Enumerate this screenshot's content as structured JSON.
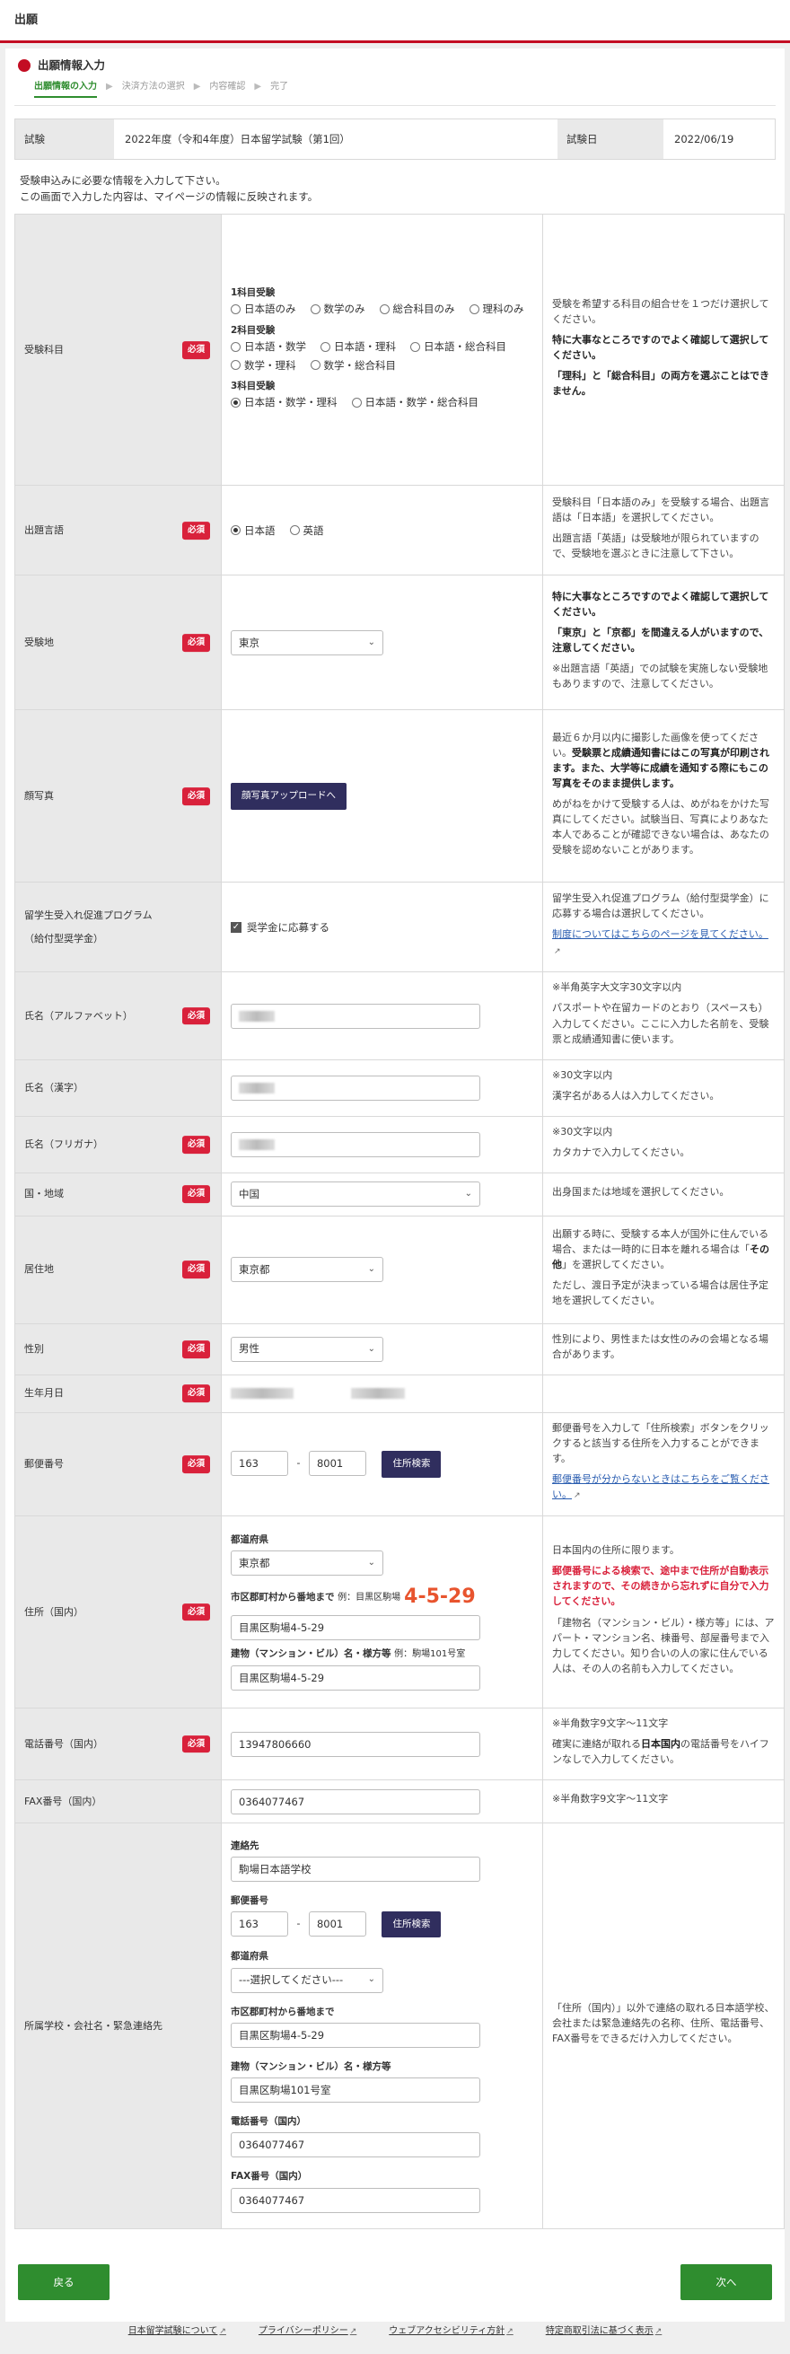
{
  "header": {
    "title": "出願"
  },
  "section": {
    "title": "出願情報入力"
  },
  "steps": [
    "出願情報の入力",
    "決済方法の選択",
    "内容確認",
    "完了"
  ],
  "exam": {
    "label": "試験",
    "value": "2022年度（令和4年度）日本留学試験（第1回）",
    "date_label": "試験日",
    "date_value": "2022/06/19"
  },
  "intro": [
    "受験申込みに必要な情報を入力して下さい。",
    "この画面で入力した内容は、マイページの情報に反映されます。"
  ],
  "required": "必須",
  "subjects": {
    "label": "受験科目",
    "g1": "1科目受験",
    "g1_options": [
      "日本語のみ",
      "数学のみ",
      "総合科目のみ",
      "理科のみ"
    ],
    "g2": "2科目受験",
    "g2_options": [
      "日本語・数学",
      "日本語・理科",
      "日本語・総合科目",
      "数学・理科",
      "数学・総合科目"
    ],
    "g3": "3科目受験",
    "g3_options": [
      "日本語・数学・理科",
      "日本語・数学・総合科目"
    ],
    "note1": "受験を希望する科目の組合せを１つだけ選択してください。",
    "note2": "特に大事なところですのでよく確認して選択してください。",
    "note3": "「理科」と「総合科目」の両方を選ぶことはできません。"
  },
  "language": {
    "label": "出題言語",
    "options": [
      "日本語",
      "英語"
    ],
    "note1": "受験科目「日本語のみ」を受験する場合、出題言語は「日本語」を選択してください。",
    "note2": "出題言語「英語」は受験地が限られていますので、受験地を選ぶときに注意して下さい。"
  },
  "venue": {
    "label": "受験地",
    "value": "東京",
    "note1": "特に大事なところですのでよく確認して選択してください。",
    "note2": "「東京」と「京都」を間違える人がいますので、注意してください。",
    "note3": "※出題言語「英語」での試験を実施しない受験地もありますので、注意してください。"
  },
  "photo": {
    "label": "顔写真",
    "button": "顔写真アップロードへ",
    "note1a": "最近６か月以内に撮影した画像を使ってください。",
    "note1b": "受験票と成績通知書にはこの写真が印刷されます。また、大学等に成績を通知する際にもこの写真をそのまま提供します。",
    "note2": "めがねをかけて受験する人は、めがねをかけた写真にしてください。試験当日、写真によりあなた本人であることが確認できない場合は、あなたの受験を認めないことがあります。"
  },
  "scholarship": {
    "label1": "留学生受入れ促進プログラム",
    "label2": "（給付型奨学金）",
    "checkbox": "奨学金に応募する",
    "note1": "留学生受入れ促進プログラム（給付型奨学金）に応募する場合は選択してください。",
    "link": "制度についてはこちらのページを見てください。"
  },
  "name_alpha": {
    "label": "氏名（アルファベット）",
    "note1": "※半角英字大文字30文字以内",
    "note2": "パスポートや在留カードのとおり（スペースも）入力してください。ここに入力した名前を、受験票と成績通知書に使います。"
  },
  "name_kanji": {
    "label": "氏名（漢字）",
    "note1": "※30文字以内",
    "note2": "漢字名がある人は入力してください。"
  },
  "name_kana": {
    "label": "氏名（フリガナ）",
    "note1": "※30文字以内",
    "note2": "カタカナで入力してください。"
  },
  "country": {
    "label": "国・地域",
    "value": "中国",
    "note": "出身国または地域を選択してください。"
  },
  "residence": {
    "label": "居住地",
    "value": "東京都",
    "note1a": "出願する時に、受験する本人が国外に住んでいる場合、または一時的に日本を離れる場合は「",
    "note1b": "その他",
    "note1c": "」を選択してください。",
    "note2": "ただし、渡日予定が決まっている場合は居住予定地を選択してください。"
  },
  "gender": {
    "label": "性別",
    "value": "男性",
    "note": "性別により、男性または女性のみの会場となる場合があります。"
  },
  "birth": {
    "label": "生年月日"
  },
  "postal": {
    "label": "郵便番号",
    "p1": "163",
    "p2": "8001",
    "dash": "-",
    "button": "住所検索",
    "note": "郵便番号を入力して「住所検索」ボタンをクリックすると該当する住所を入力することができます。",
    "link": "郵便番号が分からないときはこちらをご覧ください。"
  },
  "address": {
    "label": "住所（国内）",
    "pref_label": "都道府県",
    "pref": "東京都",
    "city_label": "市区郡町村から番地まで",
    "city_ex": "例：目黒区駒場",
    "big": "4-5-29",
    "city": "目黒区駒場4-5-29",
    "bldg_label": "建物（マンション・ビル）名・様方等",
    "bldg_ex": "例：駒場101号室",
    "bldg": "目黒区駒場4-5-29",
    "note1": "日本国内の住所に限ります。",
    "note2": "郵便番号による検索で、途中まで住所が自動表示されますので、その続きから忘れずに自分で入力してください。",
    "note3": "「建物名（マンション・ビル）・様方等」には、アパート・マンション名、棟番号、部屋番号まで入力してください。知り合いの人の家に住んでいる人は、その人の名前も入力してください。"
  },
  "phone": {
    "label": "電話番号（国内）",
    "value": "13947806660",
    "note1": "※半角数字9文字～11文字",
    "note2a": "確実に連絡が取れる",
    "note2b": "日本国内",
    "note2c": "の電話番号をハイフンなしで入力してください。"
  },
  "fax": {
    "label": "FAX番号（国内）",
    "value": "0364077467",
    "note": "※半角数字9文字～11文字"
  },
  "contact": {
    "label": "所属学校・会社名・緊急連絡先",
    "name_label": "連絡先",
    "name": "駒場日本語学校",
    "postal_label": "郵便番号",
    "p1": "163",
    "p2": "8001",
    "button": "住所検索",
    "pref_label": "都道府県",
    "pref": "---選択してください---",
    "city_label": "市区郡町村から番地まで",
    "city": "目黒区駒場4-5-29",
    "bldg_label": "建物（マンション・ビル）名・様方等",
    "bldg": "目黒区駒場101号室",
    "tel_label": "電話番号（国内）",
    "tel": "0364077467",
    "fax_label": "FAX番号（国内）",
    "fax": "0364077467",
    "note": "「住所（国内）」以外で連絡の取れる日本語学校、会社または緊急連絡先の名称、住所、電話番号、FAX番号をできるだけ入力してください。"
  },
  "nav": {
    "back": "戻る",
    "next": "次へ"
  },
  "footer": [
    "日本留学試験について",
    "プライバシーポリシー",
    "ウェブアクセシビリティ方針",
    "特定商取引法に基づく表示"
  ]
}
